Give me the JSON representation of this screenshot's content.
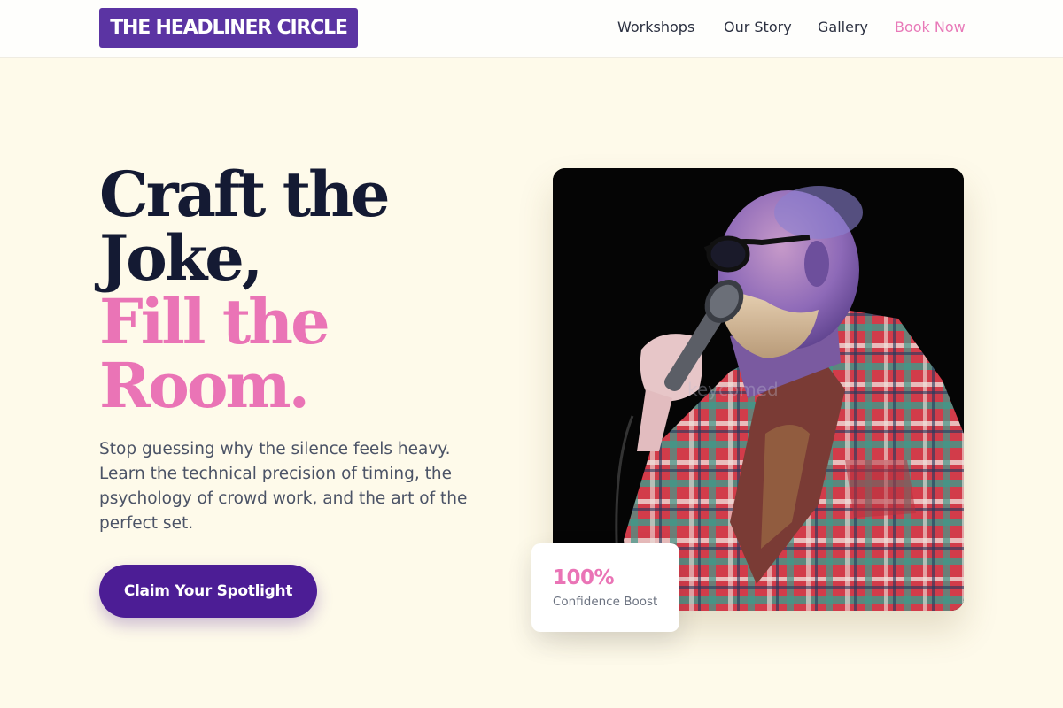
{
  "header": {
    "logo": "THE HEADLINER CIRCLE",
    "nav": [
      {
        "label": "Workshops"
      },
      {
        "label": "Our Story"
      },
      {
        "label": "Gallery"
      },
      {
        "label": "Book Now"
      }
    ]
  },
  "hero": {
    "headline": {
      "line1": "Craft the",
      "line2": "Joke,",
      "line3": "Fill the",
      "line4": "Room."
    },
    "lede": "Stop guessing why the silence feels heavy. Learn the technical precision of timing, the psychology of crowd work, and the art of the perfect set.",
    "cta_label": "Claim Your Spotlight"
  },
  "photo": {
    "watermark": "keycomed"
  },
  "stat_card": {
    "value": "100%",
    "caption": "Confidence Boost"
  },
  "colors": {
    "background": "#fefaea",
    "brand_purple": "#5b34a3",
    "cta_purple": "#4c1d95",
    "accent_pink": "#ea74b6",
    "headline_navy": "#141a33"
  }
}
